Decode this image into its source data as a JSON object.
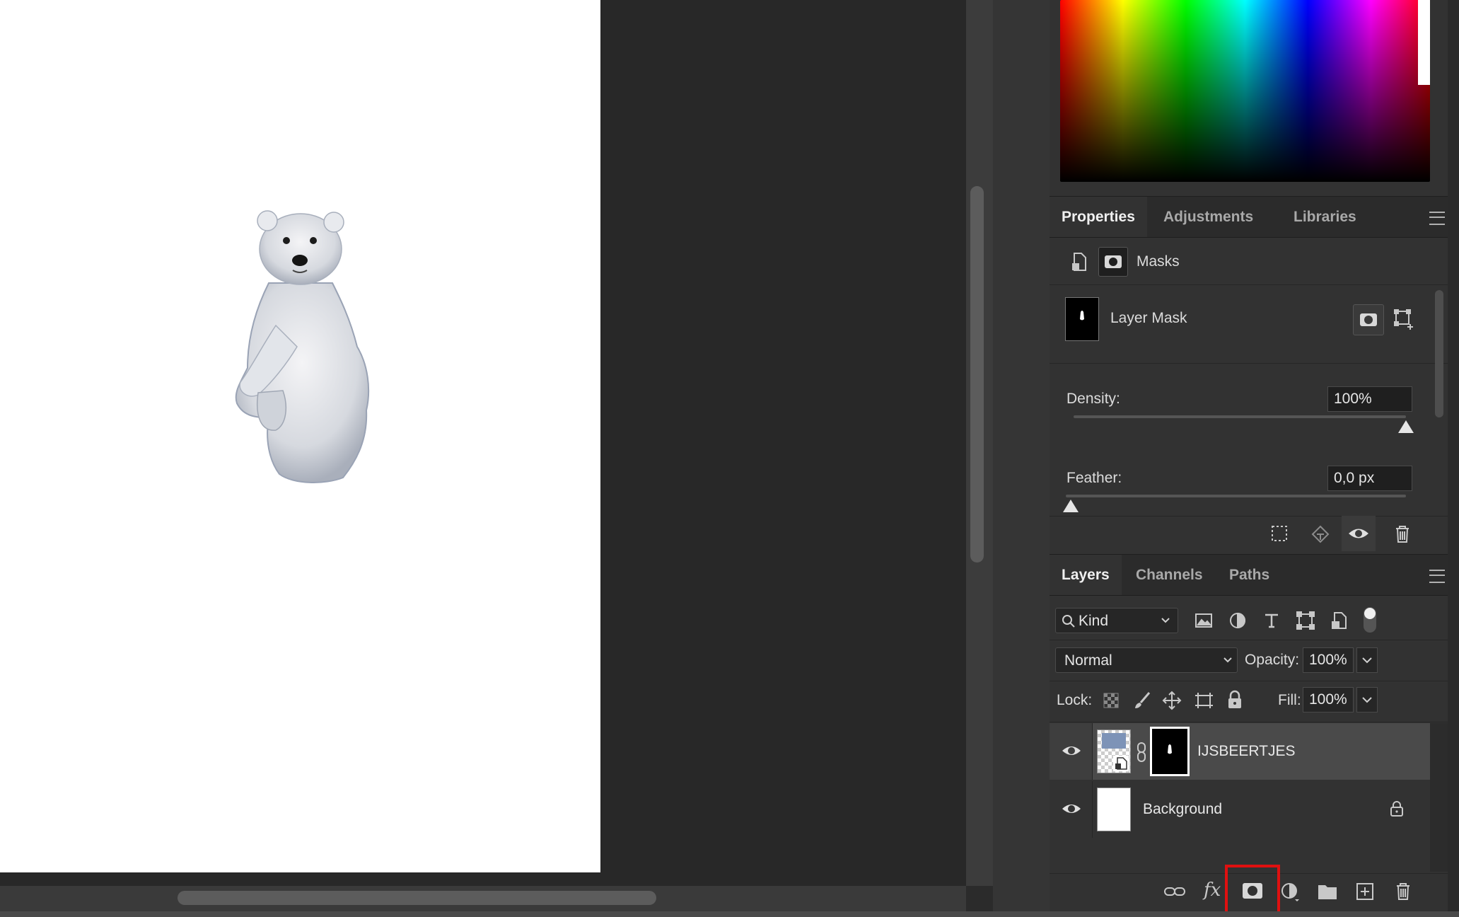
{
  "canvas": {
    "image_subject": "polar-bear-cub"
  },
  "color_picker": {
    "accent": "#ff0000"
  },
  "properties": {
    "tabs": [
      {
        "label": "Properties",
        "active": true
      },
      {
        "label": "Adjustments",
        "active": false
      },
      {
        "label": "Libraries",
        "active": false
      }
    ],
    "section_label": "Masks",
    "mask_name": "Layer Mask",
    "density_label": "Density:",
    "density_value": "100%",
    "density_level": 1.0,
    "feather_label": "Feather:",
    "feather_value": "0,0 px",
    "feather_level": 0.0,
    "footer_icons": [
      "load-selection-icon",
      "apply-mask-icon",
      "visibility-eye-icon",
      "delete-mask-icon"
    ]
  },
  "layers": {
    "tabs": [
      {
        "label": "Layers",
        "active": true
      },
      {
        "label": "Channels",
        "active": false
      },
      {
        "label": "Paths",
        "active": false
      }
    ],
    "filter_label": "Kind",
    "filter_icons": [
      "pixel-filter-icon",
      "adjustment-filter-icon",
      "type-filter-icon",
      "shape-filter-icon",
      "smart-object-filter-icon",
      "filter-toggle-icon"
    ],
    "blend_mode": "Normal",
    "opacity_label": "Opacity:",
    "opacity_value": "100%",
    "lock_label": "Lock:",
    "fill_label": "Fill:",
    "fill_value": "100%",
    "items": [
      {
        "name": "IJSBEERTJES",
        "visible": true,
        "selected": true,
        "has_mask": true,
        "locked": false
      },
      {
        "name": "Background",
        "visible": true,
        "selected": false,
        "has_mask": false,
        "locked": true
      }
    ],
    "footer_icons": [
      "link-layers-icon",
      "fx-icon",
      "add-mask-icon",
      "adjustment-layer-icon",
      "group-folder-icon",
      "new-layer-icon",
      "delete-layer-icon"
    ],
    "highlighted_button": "add-mask-icon",
    "highlight_color": "#e01010"
  }
}
